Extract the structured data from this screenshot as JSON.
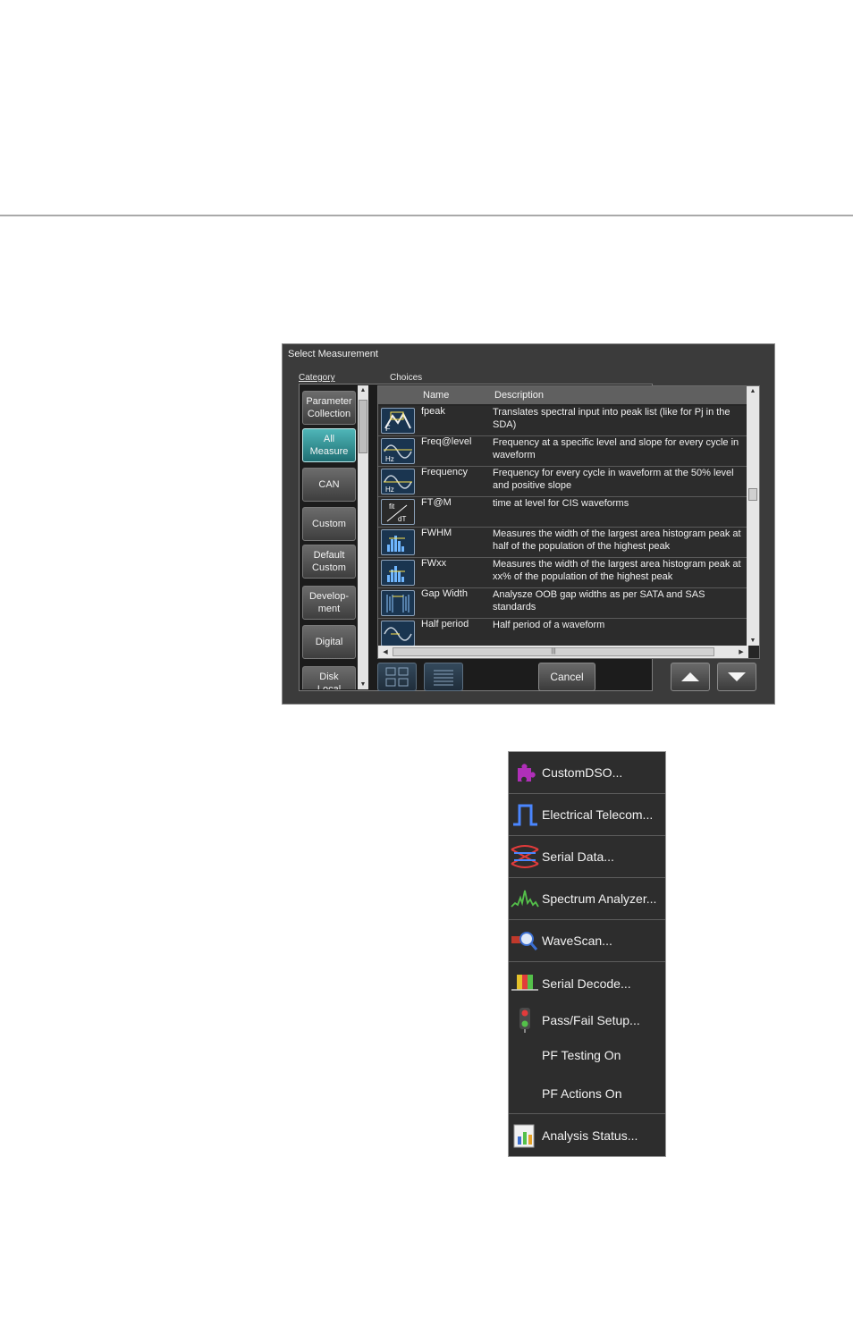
{
  "dialog": {
    "title": "Select Measurement",
    "category_label": "Category",
    "choices_label": "Choices",
    "categories": [
      {
        "label": "Parameter\nCollection"
      },
      {
        "label": "All\nMeasure",
        "selected": true
      },
      {
        "label": "CAN"
      },
      {
        "label": "Custom"
      },
      {
        "label": "Default\nCustom"
      },
      {
        "label": "Develop-\nment"
      },
      {
        "label": "Digital"
      },
      {
        "label": "Disk\nLocal"
      }
    ],
    "columns": {
      "name": "Name",
      "description": "Description"
    },
    "rows": [
      {
        "name": "fpeak",
        "desc1": "Translates spectral input into peak list (like for Pj in the",
        "desc2": "SDA)",
        "icon": "fpeak-icon"
      },
      {
        "name": "Freq@level",
        "desc1": "Frequency at a specific level and slope for every cycle in",
        "desc2": "waveform",
        "icon": "freq-level-icon"
      },
      {
        "name": "Frequency",
        "desc1": "Frequency for every cycle in waveform at the 50% level",
        "desc2": "and positive slope",
        "icon": "frequency-icon"
      },
      {
        "name": "FT@M",
        "desc1": "time at level for CIS waveforms",
        "desc2": "",
        "icon": "ft-m-icon"
      },
      {
        "name": "FWHM",
        "desc1": "Measures the width of the largest area histogram peak at",
        "desc2": "half of the population of the highest peak",
        "icon": "fwhm-icon"
      },
      {
        "name": "FWxx",
        "desc1": "Measures the width of the largest area histogram peak at",
        "desc2": "xx% of the population of the highest peak",
        "icon": "fwxx-icon"
      },
      {
        "name": "Gap Width",
        "desc1": "Analysze OOB gap widths as per SATA and SAS",
        "desc2": "standards",
        "icon": "gap-width-icon"
      },
      {
        "name": "Half period",
        "desc1": "Half period of a waveform",
        "desc2": "",
        "icon": "half-period-icon"
      }
    ],
    "icon_texts": {
      "fpeak": "F",
      "ftm_top": "fit",
      "ftm_bottom": "dT",
      "hz": "Hz"
    },
    "cancel_label": "Cancel"
  },
  "menu": {
    "items": [
      {
        "label": "CustomDSO...",
        "icon": "puzzle-icon",
        "color": "#b02fb8"
      },
      {
        "label": "Electrical Telecom...",
        "icon": "pulse-icon",
        "color": "#4a86ff"
      },
      {
        "label": "Serial Data...",
        "icon": "eye-diagram-icon",
        "color": "#e23b3b"
      },
      {
        "label": "Spectrum Analyzer...",
        "icon": "spectrum-icon",
        "color": "#54c04a"
      },
      {
        "label": "WaveScan...",
        "icon": "magnifier-icon",
        "color": "#3c6fd1"
      },
      {
        "label": "Serial Decode...",
        "icon": "decode-icon",
        "color": "#e5c22a"
      },
      {
        "label": "Pass/Fail Setup...",
        "icon": "traffic-light-icon",
        "color": "#e23b3b"
      },
      {
        "label": "PF Testing On",
        "icon": "",
        "color": ""
      },
      {
        "label": "PF Actions On",
        "icon": "",
        "color": ""
      },
      {
        "label": "Analysis Status...",
        "icon": "analysis-chart-icon",
        "color": "#3c6fd1"
      }
    ]
  }
}
